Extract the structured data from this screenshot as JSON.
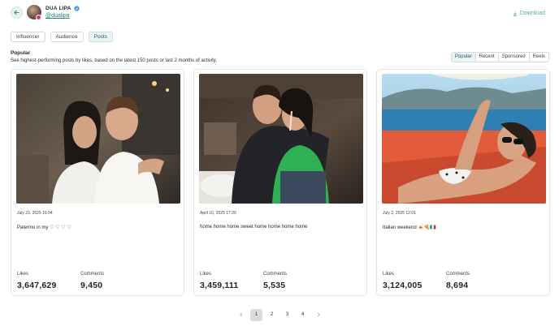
{
  "profile": {
    "name": "DUA LIPA",
    "handle": "@dualipa"
  },
  "header": {
    "download_label": "Download"
  },
  "tabs": [
    {
      "label": "Influencer",
      "active": false
    },
    {
      "label": "Audience",
      "active": false
    },
    {
      "label": "Posts",
      "active": true
    }
  ],
  "section": {
    "title": "Popular",
    "description": "See highest-performing posts by likes, based on the latest 150 posts or last 2 months of activity."
  },
  "sort_options": [
    {
      "label": "Popular",
      "active": true
    },
    {
      "label": "Recent",
      "active": false
    },
    {
      "label": "Sponsored",
      "active": false
    },
    {
      "label": "Reels",
      "active": false
    }
  ],
  "posts": [
    {
      "date": "July 23, 2025 16:04",
      "caption": "Palermo in my ♡ ♡ ♡ ♡",
      "likes_label": "Likes",
      "likes": "3,647,629",
      "comments_label": "Comments",
      "comments": "9,450"
    },
    {
      "date": "April 10, 2025 17:20",
      "caption": "home home home sweet home home home home",
      "likes_label": "Likes",
      "likes": "3,459,111",
      "comments_label": "Comments",
      "comments": "5,535"
    },
    {
      "date": "July 2, 2025 12:01",
      "caption": "Italian weekend 🍝🍕🇮🇹",
      "likes_label": "Likes",
      "likes": "3,124,005",
      "comments_label": "Comments",
      "comments": "8,694"
    }
  ],
  "pagination": {
    "pages": [
      "1",
      "2",
      "3",
      "4"
    ],
    "current": "1"
  },
  "colors": {
    "accent": "#1b7f72",
    "active_tab_bg": "#e9f4f6",
    "border": "#d6dadd"
  }
}
